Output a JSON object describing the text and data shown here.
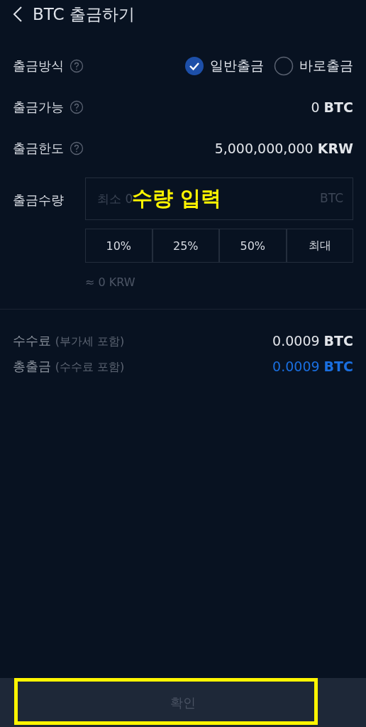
{
  "header": {
    "title": "BTC 출금하기"
  },
  "method": {
    "label": "출금방식",
    "options": [
      {
        "label": "일반출금",
        "selected": true
      },
      {
        "label": "바로출금",
        "selected": false
      }
    ]
  },
  "info_rows": [
    {
      "label": "출금가능",
      "value": "0",
      "unit": "BTC"
    },
    {
      "label": "출금한도",
      "value": "5,000,000,000",
      "unit": "KRW"
    }
  ],
  "amount": {
    "label": "출금수량",
    "placeholder": "최소 0",
    "unit": "BTC",
    "presets": [
      "10%",
      "25%",
      "50%",
      "최대"
    ],
    "estimate": "≈ 0 KRW"
  },
  "summary": [
    {
      "label": "수수료",
      "note": "(부가세 포함)",
      "value": "0.0009",
      "unit": "BTC",
      "highlight": false
    },
    {
      "label": "총출금",
      "note": "(수수료 포함)",
      "value": "0.0009",
      "unit": "BTC",
      "highlight": true
    }
  ],
  "confirm": {
    "label": "확인",
    "disabled": true
  },
  "annotations": {
    "field_label": "수량 입력",
    "highlight_confirm": true
  }
}
